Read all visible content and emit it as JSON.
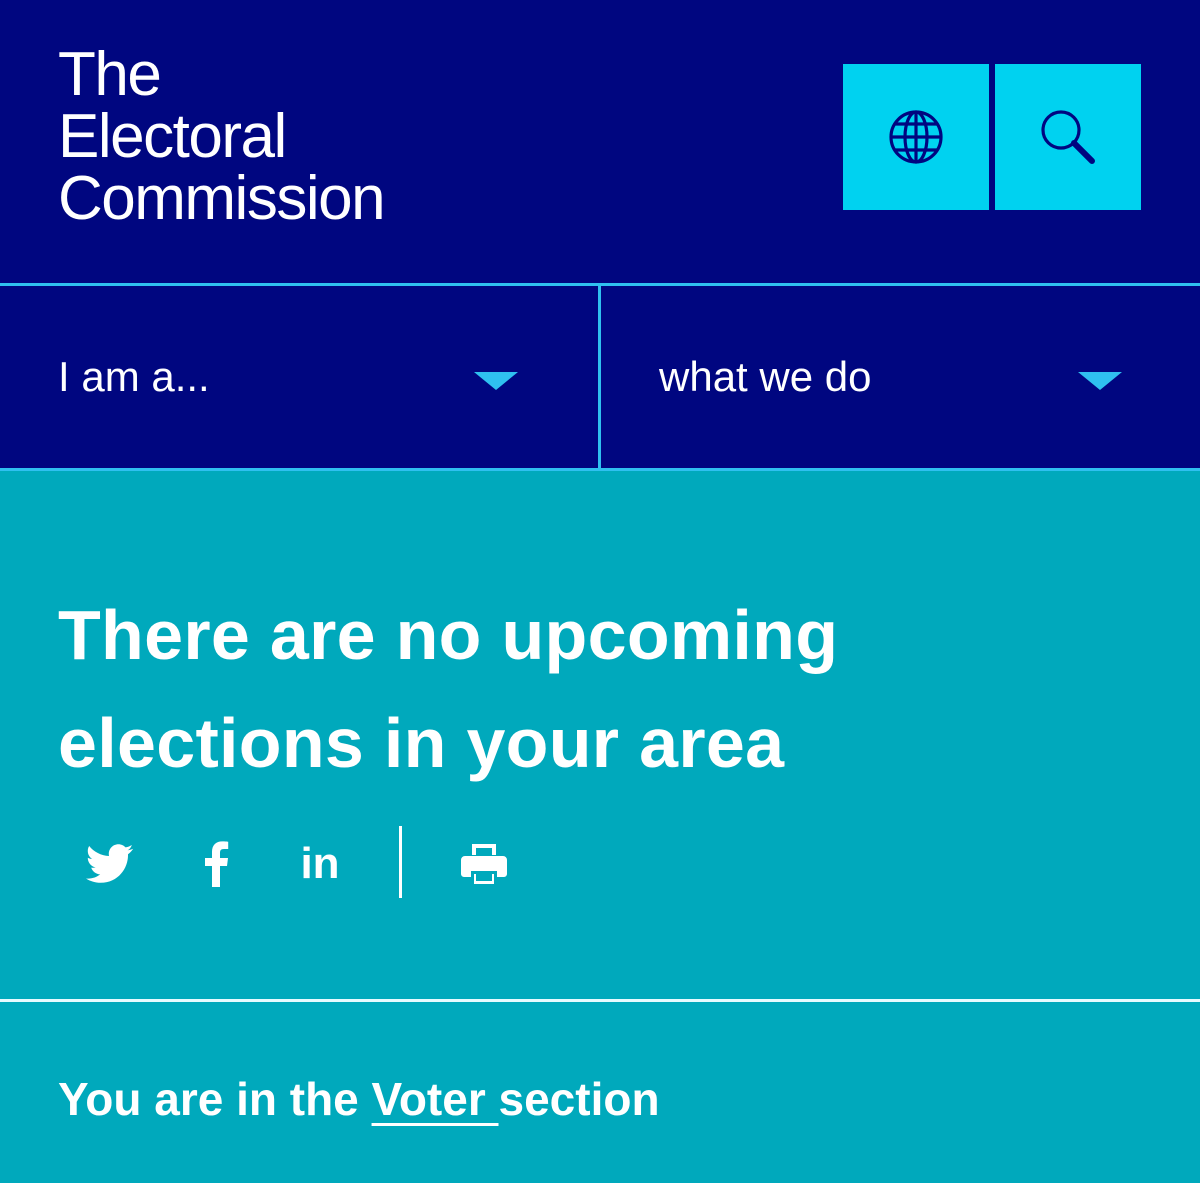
{
  "header": {
    "logo": {
      "line1": "The",
      "line2": "Electoral",
      "line3": "Commission"
    },
    "buttons": {
      "language_icon": "globe-icon",
      "search_icon": "search-icon"
    }
  },
  "nav": {
    "items": [
      {
        "label": "I am a..."
      },
      {
        "label": "what we do"
      }
    ],
    "caret_icon": "chevron-down-icon"
  },
  "hero": {
    "title": "There are no upcoming elections in your area",
    "share": {
      "twitter_icon": "twitter-icon",
      "facebook_icon": "facebook-icon",
      "linkedin_label": "in",
      "print_icon": "print-icon"
    }
  },
  "section": {
    "prefix": "You are in the ",
    "link": "Voter ",
    "suffix": "section"
  },
  "colors": {
    "header_bg": "#000680",
    "accent_cyan": "#00d2f0",
    "line_cyan": "#2fc0f0",
    "hero_bg": "#00a9bc",
    "text_white": "#ffffff"
  }
}
